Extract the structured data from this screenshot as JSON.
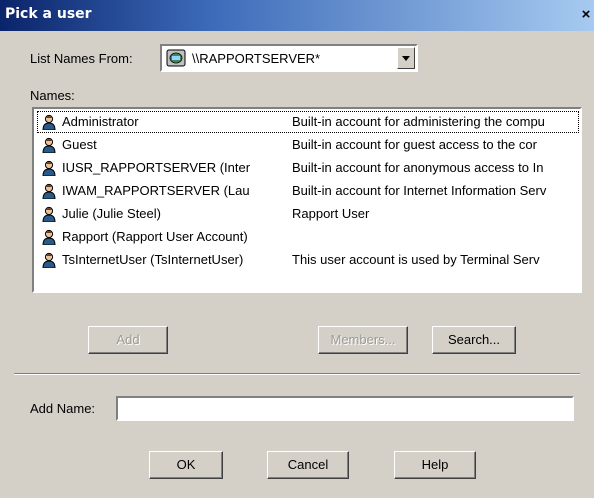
{
  "window": {
    "title": "Pick a user",
    "close_glyph": "×"
  },
  "list_from": {
    "label": "List Names From:",
    "value": "\\\\RAPPORTSERVER*",
    "icon": "server-icon"
  },
  "names_label": "Names:",
  "users": [
    {
      "name": "Administrator",
      "description": "Built-in account for administering the compu"
    },
    {
      "name": "Guest",
      "description": "Built-in account for guest access to the cor"
    },
    {
      "name": "IUSR_RAPPORTSERVER (Inter",
      "description": "Built-in account for anonymous access to In"
    },
    {
      "name": "IWAM_RAPPORTSERVER (Lau",
      "description": "Built-in account for Internet Information Serv"
    },
    {
      "name": "Julie (Julie Steel)",
      "description": "Rapport User"
    },
    {
      "name": "Rapport (Rapport User Account)",
      "description": ""
    },
    {
      "name": "TsInternetUser (TsInternetUser)",
      "description": "This user account is used by Terminal Serv"
    }
  ],
  "buttons": {
    "add": "Add",
    "members": "Members...",
    "search": "Search...",
    "ok": "OK",
    "cancel": "Cancel",
    "help": "Help"
  },
  "add_name": {
    "label": "Add Name:",
    "value": ""
  }
}
